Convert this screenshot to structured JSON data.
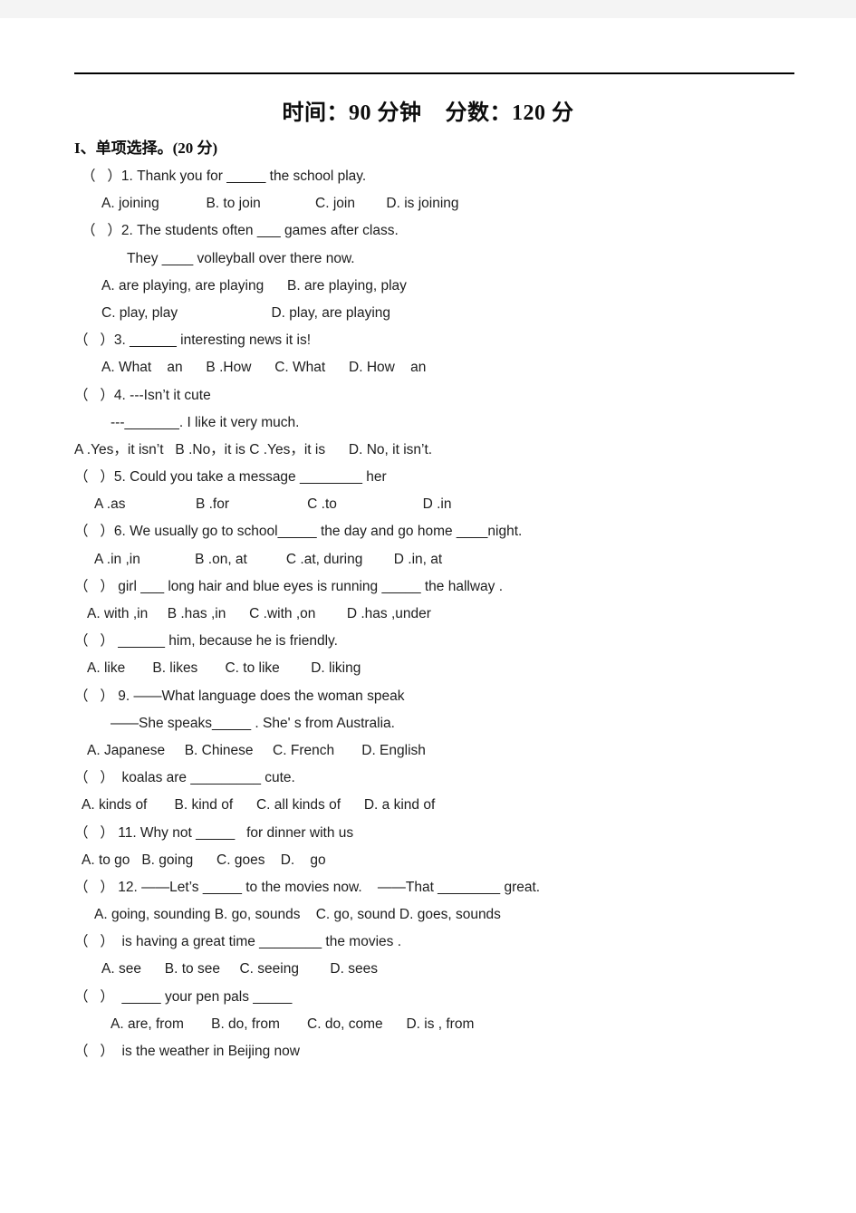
{
  "document": {
    "title": "时间：90 分钟    分数：120 分",
    "section_heading": "I、单项选择。(20 分)"
  },
  "lines": [
    {
      "text": "（   ）1. Thank you for _____ the school play.",
      "indent": "i1"
    },
    {
      "text": "A. joining            B. to join              C. join        D. is joining",
      "indent": "i4"
    },
    {
      "text": "（   ）2. The students often ___ games after class.",
      "indent": "i1"
    },
    {
      "text": "They ____ volleyball over there now.",
      "indent": "i6"
    },
    {
      "text": "A. are playing, are playing      B. are playing, play",
      "indent": "i4"
    },
    {
      "text": "C. play, play                        D. play, are playing",
      "indent": "i4"
    },
    {
      "text": "（   ）3. ______ interesting news it is!",
      "indent": "i0"
    },
    {
      "text": "A. What    an      B .How      C. What      D. How    an",
      "indent": "i4"
    },
    {
      "text": "（   ）4. ---Isn’t it cute",
      "indent": "i0"
    },
    {
      "text": "---_______. I like it very much.",
      "indent": "i5"
    },
    {
      "text": "A .Yes，it isn’t   B .No，it is C .Yes，it is      D. No, it isn’t.",
      "indent": "i0"
    },
    {
      "text": "（   ）5. Could you take a message ________ her",
      "indent": "i0"
    },
    {
      "text": "A .as                  B .for                    C .to                      D .in",
      "indent": "i3"
    },
    {
      "text": "（   ）6. We usually go to school_____ the day and go home ____night.",
      "indent": "i0"
    },
    {
      "text": "A .in ,in              B .on, at          C .at, during        D .in, at",
      "indent": "i3"
    },
    {
      "text": "（   ） girl ___ long hair and blue eyes is running _____ the hallway .",
      "indent": "i0"
    },
    {
      "text": "A. with ,in     B .has ,in      C .with ,on        D .has ,under",
      "indent": "i2"
    },
    {
      "text": "（   ） ______ him, because he is friendly.",
      "indent": "i0"
    },
    {
      "text": "A. like       B. likes       C. to like        D. liking",
      "indent": "i2"
    },
    {
      "text": "（   ） 9. ——What language does the woman speak",
      "indent": "i0"
    },
    {
      "text": "——She speaks_____ . She' s from Australia.",
      "indent": "i5"
    },
    {
      "text": "A. Japanese     B. Chinese     C. French       D. English",
      "indent": "i2"
    },
    {
      "text": "（   ）  koalas are _________ cute.",
      "indent": "i0"
    },
    {
      "text": "A. kinds of       B. kind of      C. all kinds of      D. a kind of",
      "indent": "i1"
    },
    {
      "text": "（   ） 11. Why not _____   for dinner with us",
      "indent": "i0"
    },
    {
      "text": "A. to go   B. going      C. goes    D.    go",
      "indent": "i1"
    },
    {
      "text": "（   ） 12. ——Let’s _____ to the movies now.    ——That ________ great.",
      "indent": "i0"
    },
    {
      "text": "A. going, sounding B. go, sounds    C. go, sound D. goes, sounds",
      "indent": "i3"
    },
    {
      "text": "（   ）  is having a great time ________ the movies .",
      "indent": "i0"
    },
    {
      "text": "A. see      B. to see     C. seeing        D. sees",
      "indent": "i4"
    },
    {
      "text": "（   ）  _____ your pen pals _____",
      "indent": "i0"
    },
    {
      "text": "A. are, from       B. do, from       C. do, come      D. is , from",
      "indent": "i5"
    },
    {
      "text": "（   ）  is the weather in Beijing now",
      "indent": "i0"
    }
  ]
}
